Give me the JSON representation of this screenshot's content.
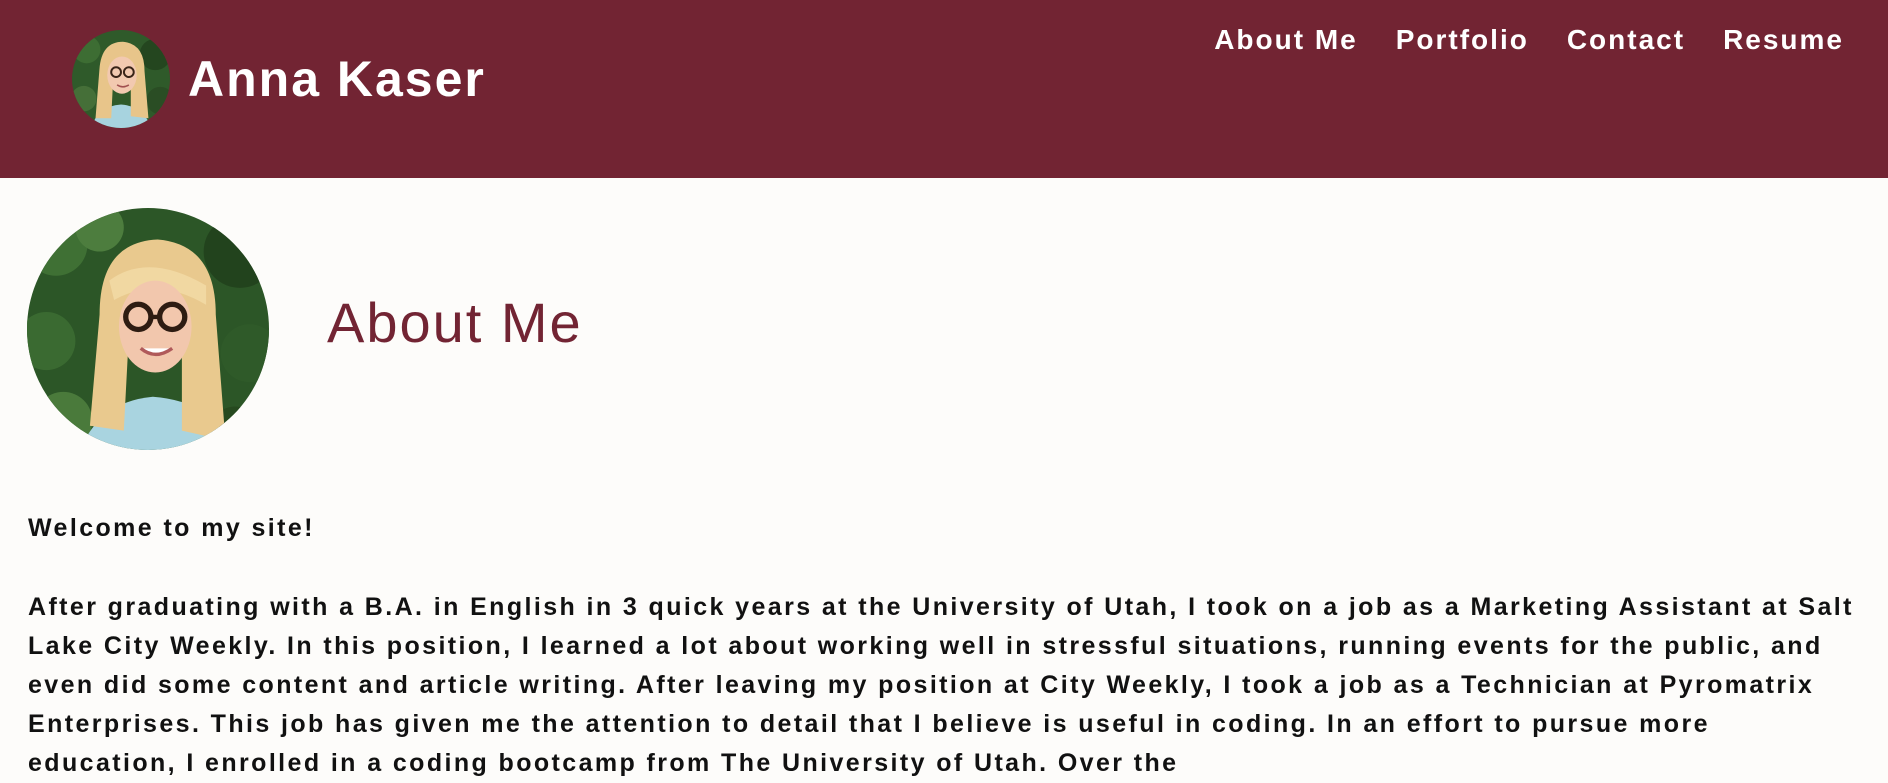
{
  "brand": {
    "name": "Anna Kaser",
    "avatar": "profile-photo"
  },
  "nav": {
    "items": [
      {
        "label": "About Me"
      },
      {
        "label": "Portfolio"
      },
      {
        "label": "Contact"
      },
      {
        "label": "Resume"
      }
    ]
  },
  "about": {
    "title": "About Me",
    "photo": "profile-photo",
    "welcome": "Welcome to my site!",
    "bio": "After graduating with a B.A. in English in 3 quick years at the University of Utah, I took on a job as a Marketing Assistant at Salt Lake City Weekly. In this position, I learned a lot about working well in stressful situations, running events for the public, and even did some content and article writing. After leaving my position at City Weekly, I took a job as a Technician at Pyromatrix Enterprises. This job has given me the attention to detail that I believe is useful in coding. In an effort to pursue more education, I enrolled in a coding bootcamp from The University of Utah. Over the"
  },
  "colors": {
    "header_bg": "#722433",
    "accent": "#722433",
    "page_bg": "#fdfcfa",
    "text": "#111111",
    "nav_text": "#ffffff"
  }
}
